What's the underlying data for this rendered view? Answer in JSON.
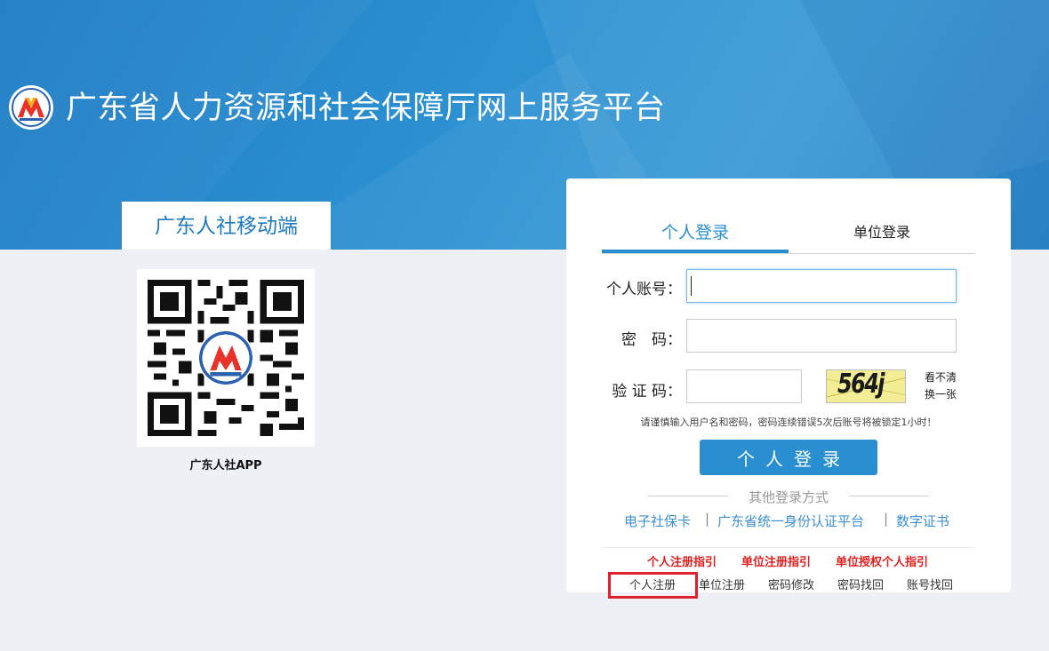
{
  "header": {
    "site_title": "广东省人力资源和社会保障厅网上服务平台",
    "logo_icon": "hrss-logo-icon"
  },
  "mobile": {
    "tab_label": "广东人社移动端",
    "qr_icon": "qr-code-icon",
    "qr_caption": "广东人社APP"
  },
  "login": {
    "tabs": [
      {
        "label": "个人登录",
        "active": true
      },
      {
        "label": "单位登录",
        "active": false
      }
    ],
    "account_label": "个人账号：",
    "account_value": "",
    "password_label": "密　码：",
    "captcha_label": "验 证 码：",
    "captcha_text": "564j",
    "refresh_label_1": "看不清",
    "refresh_label_2": "换一张",
    "warning": "请谨慎输入用户名和密码，密码连续错误5次后账号将被锁定1小时！",
    "submit_label": "个人登录",
    "other_methods_label": "其他登录方式",
    "alt_methods": [
      "电子社保卡",
      "广东省统一身份认证平台",
      "数字证书"
    ],
    "alt_separator": "|",
    "guides": [
      "个人注册指引",
      "单位注册指引",
      "单位授权个人指引"
    ],
    "footer_links": [
      "个人注册",
      "单位注册",
      "密码修改",
      "密码找回",
      "账号找回"
    ]
  },
  "colors": {
    "primary": "#2a8fd0",
    "banner": "#2a8fd0",
    "guide_red": "#e02020",
    "highlight": "#e0202a"
  }
}
